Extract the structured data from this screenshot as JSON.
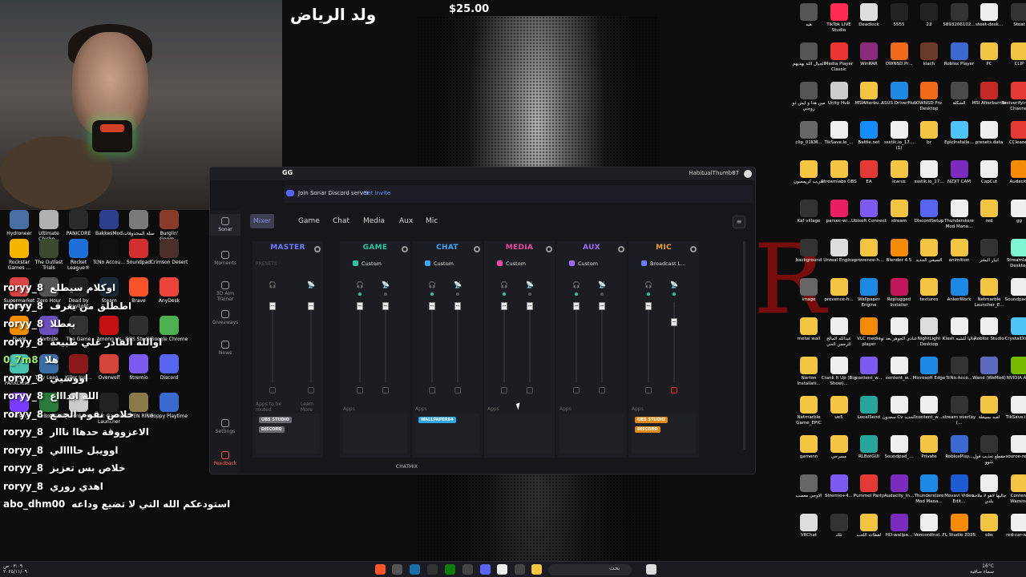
{
  "stream_overlay": {
    "title_arabic": "ولد الرياض",
    "donation": "$25.00"
  },
  "left_desktop_icons": [
    {
      "label": "Hydroneer",
      "color": "#4a6fa5"
    },
    {
      "label": "Ultimate Chicke...",
      "color": "#b0b0b0"
    },
    {
      "label": "PANICORE",
      "color": "#2a2a2a"
    },
    {
      "label": "BakkesMod",
      "color": "#2d3e8c"
    },
    {
      "label": "سلة المحذوفات",
      "color": "#7a7a7a"
    },
    {
      "label": "Burglin' Gnom...",
      "color": "#8a3a2a"
    },
    {
      "label": "Rockstar Games ...",
      "color": "#f4b400"
    },
    {
      "label": "The Outlast Trials",
      "color": "#3b4a2e"
    },
    {
      "label": "Rocket League®",
      "color": "#1e6fd9"
    },
    {
      "label": "TcNo Accou...",
      "color": "#111111"
    },
    {
      "label": "Soundpad",
      "color": "#d32f2f"
    },
    {
      "label": "Crimson Desert",
      "color": "#4a2f2a"
    },
    {
      "label": "Supermarket Togethe...",
      "color": "#d94545"
    },
    {
      "label": "Zero Hour",
      "color": "#555555"
    },
    {
      "label": "Dead by Daylight",
      "color": "#222222"
    },
    {
      "label": "Steam",
      "color": "#1b2838"
    },
    {
      "label": "Brave",
      "color": "#fb542b"
    },
    {
      "label": "AnyDesk",
      "color": "#ef443b"
    },
    {
      "label": "FiveM",
      "color": "#f08c00"
    },
    {
      "label": "Fortnite",
      "color": "#6b4fbb"
    },
    {
      "label": "The Game",
      "color": "#333333"
    },
    {
      "label": "Among Us",
      "color": "#c51111"
    },
    {
      "label": "OBS Studio",
      "color": "#302e31"
    },
    {
      "label": "Google Chrome",
      "color": "#4caf50"
    },
    {
      "label": "PICO PARKClass...",
      "color": "#49c3b1"
    },
    {
      "label": "Tiny Leag...",
      "color": "#3a6ea5"
    },
    {
      "label": "Killer Inst...",
      "color": "#8a1a1a"
    },
    {
      "label": "Overwolf",
      "color": "#d4463a"
    },
    {
      "label": "Stremio",
      "color": "#7b5bf2"
    },
    {
      "label": "Discord",
      "color": "#5865f2"
    },
    {
      "label": "Parsec",
      "color": "#7a3cff"
    },
    {
      "label": "RLBotGUI",
      "color": "#2a7a3a"
    },
    {
      "label": "Vencord Inst...",
      "color": "#cccccc"
    },
    {
      "label": "Epic Games Launcher",
      "color": "#222222"
    },
    {
      "label": "ELDEN RING",
      "color": "#8a7a4a"
    },
    {
      "label": "Poppy Playtime",
      "color": "#3a6ad0"
    }
  ],
  "chat": [
    {
      "user": "roryy_8",
      "msg": "اوكلام سيطلع"
    },
    {
      "user": "roryy_8",
      "msg": "اططلق من يعرف"
    },
    {
      "user": "roryy_8",
      "msg": "يعطلا"
    },
    {
      "user": "roryy_8",
      "msg": "اوالله القادر علي طبيعة"
    },
    {
      "user": "0_7m8",
      "msg": "هلا"
    },
    {
      "user": "roryy_8",
      "msg": "اووسيي"
    },
    {
      "user": "roryy_8",
      "msg": "الله ابداااع"
    },
    {
      "user": "roryy_8",
      "msg": "خلاص نقوم الجمع"
    },
    {
      "user": "roryy_8",
      "msg": "الاعزووقة حدهاا نااار"
    },
    {
      "user": "roryy_8",
      "msg": "اوويبل حاااالي"
    },
    {
      "user": "roryy_8",
      "msg": "خلاص بس تعزيز"
    },
    {
      "user": "roryy_8",
      "msg": "اهدي روري"
    },
    {
      "user": "abo_dhm00",
      "msg": "استودعكم الله التي لا تضيع وداعه"
    }
  ],
  "sonar": {
    "window_title": "GG",
    "username": "HabitualThumb87",
    "discord_banner": "Join Sonar Discord server",
    "discord_link": "Get invite",
    "nav": [
      {
        "label": "Sonar",
        "active": true
      },
      {
        "label": "Moments"
      },
      {
        "label": "3D Aim Trainer"
      },
      {
        "label": "Giveaways"
      },
      {
        "label": "News"
      },
      {
        "label": "Settings"
      },
      {
        "label": "Feedback"
      }
    ],
    "tabs": [
      "Mixer",
      "Game",
      "Chat",
      "Media",
      "Aux",
      "Mic"
    ],
    "presets_label": "PRESETS",
    "apps_label": "Apps",
    "apps_to_be_routed": "Apps to be routed",
    "learn_more": "Learn More",
    "chatmix_label": "CHATMIX",
    "channels": [
      {
        "name": "MASTER",
        "color": "#6e7cff",
        "preset": "",
        "preset_color": "",
        "mon_level": 0.05,
        "stream_level": 0.05,
        "chips": [
          {
            "text": "OBS STUDIO",
            "bg": "#6b6d75"
          },
          {
            "text": "DISCORD",
            "bg": "#6b6d75"
          }
        ]
      },
      {
        "name": "GAME",
        "color": "#2ec4a0",
        "preset": "Custom",
        "preset_color": "#2ec4a0",
        "mon_level": 0.05,
        "stream_level": 0.05,
        "chips": []
      },
      {
        "name": "CHAT",
        "color": "#3ba6f5",
        "preset": "Custom",
        "preset_color": "#3ba6f5",
        "mon_level": 0.05,
        "stream_level": 0.05,
        "chips": [
          {
            "text": "WALLPAPER64",
            "bg": "#2fa6e6"
          }
        ]
      },
      {
        "name": "MEDIA",
        "color": "#e94aa0",
        "preset": "Custom",
        "preset_color": "#e94aa0",
        "mon_level": 0.05,
        "stream_level": 0.05,
        "chips": []
      },
      {
        "name": "AUX",
        "color": "#9b6cf2",
        "preset": "Custom",
        "preset_color": "#9b6cf2",
        "mon_level": 0.05,
        "stream_level": 0.05,
        "chips": []
      },
      {
        "name": "MIC",
        "color": "#f0a030",
        "preset": "Broadcast L...",
        "preset_color": "#6e7cff",
        "mon_level": 0.05,
        "stream_level": 0.25,
        "chips": [
          {
            "text": "OBS STUDIO",
            "bg": "#e08a1a"
          },
          {
            "text": "DISCORD",
            "bg": "#e08a1a"
          }
        ]
      }
    ]
  },
  "right_desktop_icons": [
    {
      "label": "هيه",
      "color": "#555"
    },
    {
      "label": "TikTok LIVE Studio",
      "color": "#fe2c55"
    },
    {
      "label": "Deadlock",
      "color": "#ddd"
    },
    {
      "label": "5555",
      "color": "#222"
    },
    {
      "label": "22",
      "color": "#222"
    },
    {
      "label": "5893206102...",
      "color": "#333"
    },
    {
      "label": "stoet-desk...",
      "color": "#eee"
    },
    {
      "label": "Stoat",
      "color": "#333"
    },
    {
      "label": "الجبال الله يهديهم",
      "color": "#555"
    },
    {
      "label": "Media Player Classic",
      "color": "#e33"
    },
    {
      "label": "WinRAR",
      "color": "#8a2a7a"
    },
    {
      "label": "OWNSD.Pr...",
      "color": "#f06a1a"
    },
    {
      "label": "klach",
      "color": "#6a3a2a"
    },
    {
      "label": "Roblox Player",
      "color": "#3a6ad0"
    },
    {
      "label": "PC",
      "color": "#f4c542"
    },
    {
      "label": "CLIP",
      "color": "#f4c542"
    },
    {
      "label": "مين هذا و ايش ذو زوجتي",
      "color": "#555"
    },
    {
      "label": "Unity Hub",
      "color": "#ccc"
    },
    {
      "label": "MSIAfterbu...",
      "color": "#f4c542"
    },
    {
      "label": "ASUS DriverHub",
      "color": "#1e88e5"
    },
    {
      "label": "OWNSD Pro Desktop",
      "color": "#f06a1a"
    },
    {
      "label": "الشكلة",
      "color": "#4a4a4a"
    },
    {
      "label": "MSI Afterburner",
      "color": "#c62828"
    },
    {
      "label": "Textverifyin... to Channel",
      "color": "#e53935"
    },
    {
      "label": "clip_01KM...",
      "color": "#666"
    },
    {
      "label": "TikSave.io_...",
      "color": "#eee"
    },
    {
      "label": "Battle.net",
      "color": "#148eff"
    },
    {
      "label": "ssstik.io_17... (1)",
      "color": "#eee"
    },
    {
      "label": "br",
      "color": "#f4c542"
    },
    {
      "label": "EpicInstalle...",
      "color": "#4fc3f7"
    },
    {
      "label": "presets.data",
      "color": "#eee"
    },
    {
      "label": "CCleaner",
      "color": "#e53935"
    },
    {
      "label": "تعريب كريمسون",
      "color": "#f4c542"
    },
    {
      "label": "Streamlabs OBS",
      "color": "#f4c542"
    },
    {
      "label": "EA",
      "color": "#e53935"
    },
    {
      "label": "Icarus",
      "color": "#f4c542"
    },
    {
      "label": "ssstik.io_17...",
      "color": "#eee"
    },
    {
      "label": "NZXT CAM",
      "color": "#7b2cbf"
    },
    {
      "label": "CapCut",
      "color": "#eee"
    },
    {
      "label": "Audacity",
      "color": "#f58a07"
    },
    {
      "label": "Kaf village",
      "color": "#333"
    },
    {
      "label": "parsec-wi...",
      "color": "#e91e63"
    },
    {
      "label": "Ubisoft Connect",
      "color": "#7b5bf2"
    },
    {
      "label": "stream",
      "color": "#f4c542"
    },
    {
      "label": "DiscordSetup",
      "color": "#5865f2"
    },
    {
      "label": "Thunderstore Mod Mana...",
      "color": "#eee"
    },
    {
      "label": "red",
      "color": "#f4c542"
    },
    {
      "label": "gg",
      "color": "#eee"
    },
    {
      "label": "background",
      "color": "#333"
    },
    {
      "label": "Unreal Engine",
      "color": "#ddd"
    },
    {
      "label": "provence-h...",
      "color": "#f4c542"
    },
    {
      "label": "Blender 4.5",
      "color": "#f58a07"
    },
    {
      "label": "السيفي الجديد",
      "color": "#f4c542"
    },
    {
      "label": "animition",
      "color": "#f4c542"
    },
    {
      "label": "ابيار البشر",
      "color": "#333"
    },
    {
      "label": "Streamlabs Desktop",
      "color": "#80f5d2"
    },
    {
      "label": "image",
      "color": "#666"
    },
    {
      "label": "provence-h...",
      "color": "#f4c542"
    },
    {
      "label": "Wallpaper Engine",
      "color": "#1e88e5"
    },
    {
      "label": "Replugged Installer",
      "color": "#c2185b"
    },
    {
      "label": "textures",
      "color": "#f4c542"
    },
    {
      "label": "AnkerWork",
      "color": "#1e88e5"
    },
    {
      "label": "Netmarble Launcher_E...",
      "color": "#f4c542"
    },
    {
      "label": "Soundpad_...",
      "color": "#eee"
    },
    {
      "label": "metal wall",
      "color": "#f4c542"
    },
    {
      "label": "عبدالله المالح للرحمن الحي",
      "color": "#eee"
    },
    {
      "label": "VLC media player",
      "color": "#f58a07"
    },
    {
      "label": "عنادي الجوهر بعد تو",
      "color": "#eee"
    },
    {
      "label": "NightLight Desktop",
      "color": "#ddd"
    },
    {
      "label": "Klash جاليا للشبه",
      "color": "#eee"
    },
    {
      "label": "Roblox Studio",
      "color": "#eee"
    },
    {
      "label": "CrystalDiskM",
      "color": "#4fc3f7"
    },
    {
      "label": "Norton Installati...",
      "color": "#f4c542"
    },
    {
      "label": "Crank It Up (Big Show)...",
      "color": "#eee"
    },
    {
      "label": "content_w...",
      "color": "#7b5bf2"
    },
    {
      "label": "content_w...",
      "color": "#eee"
    },
    {
      "label": "Microsoft Edge",
      "color": "#1e88e5"
    },
    {
      "label": "TcNo.Acco...",
      "color": "#333"
    },
    {
      "label": "Wand (WeMod)",
      "color": "#5c6bc0"
    },
    {
      "label": "NVIDIA App",
      "color": "#76b900"
    },
    {
      "label": "Netmarble Game_EPIC",
      "color": "#f4c542"
    },
    {
      "label": "ue5",
      "color": "#f4c542"
    },
    {
      "label": "LocalSend",
      "color": "#26a69a"
    },
    {
      "label": "سعدون Cv الجديد",
      "color": "#eee"
    },
    {
      "label": "content_w...",
      "color": "#eee"
    },
    {
      "label": "stream overlay (...",
      "color": "#333"
    },
    {
      "label": "لعبه بسيطة",
      "color": "#f4c542"
    },
    {
      "label": "TikSave.io...",
      "color": "#eee"
    },
    {
      "label": "gamenn",
      "color": "#f4c542"
    },
    {
      "label": "مسرحي",
      "color": "#f4c542"
    },
    {
      "label": "RLBotGUI",
      "color": "#26a69a"
    },
    {
      "label": "Soundpad_...",
      "color": "#eee"
    },
    {
      "label": "Private",
      "color": "#f4c542"
    },
    {
      "label": "RobloxPlay...",
      "color": "#3a6ad0"
    },
    {
      "label": "مقطع تعذيب فول شوو",
      "color": "#333"
    },
    {
      "label": "source-rec...",
      "color": "#eee"
    },
    {
      "label": "الاوجي معصب",
      "color": "#666"
    },
    {
      "label": "Stremio+4...",
      "color": "#7b5bf2"
    },
    {
      "label": "Pummel Party",
      "color": "#e53935"
    },
    {
      "label": "Audacity_In...",
      "color": "#7b2cbf"
    },
    {
      "label": "Thunderstore Mod Mana...",
      "color": "#1e88e5"
    },
    {
      "label": "Movavi Video Edit...",
      "color": "#1e5bd0"
    },
    {
      "label": "جاليها لاهو لا ملاحة بلدي",
      "color": "#eee"
    },
    {
      "label": "Content Warning",
      "color": "#f4c542"
    },
    {
      "label": "VRChat",
      "color": "#ddd"
    },
    {
      "label": "تلك",
      "color": "#333"
    },
    {
      "label": "لقطات اللعب",
      "color": "#f4c542"
    },
    {
      "label": "HD-wallpa...",
      "color": "#7b2cbf"
    },
    {
      "label": "VencordInst...",
      "color": "#eee"
    },
    {
      "label": "FL Studio 2025",
      "color": "#f58a07"
    },
    {
      "label": "obs",
      "color": "#f4c542"
    },
    {
      "label": "red-car-wr...",
      "color": "#eee"
    }
  ],
  "taskbar": {
    "clock": "٠٣:٠٩ ص",
    "date": "٢٠٢٥/١١/٠٩",
    "search_placeholder": "بحث",
    "weather_temp": "16°C",
    "weather_text": "سماء صافية",
    "apps": [
      {
        "name": "brave",
        "color": "#fb542b"
      },
      {
        "name": "obs",
        "color": "#555"
      },
      {
        "name": "steam",
        "color": "#1b6fa8"
      },
      {
        "name": "epic",
        "color": "#333"
      },
      {
        "name": "xbox",
        "color": "#107c10"
      },
      {
        "name": "controller",
        "color": "#444"
      },
      {
        "name": "discord",
        "color": "#5865f2"
      },
      {
        "name": "steelseries",
        "color": "#eee"
      },
      {
        "name": "calculator",
        "color": "#444"
      },
      {
        "name": "file-explorer",
        "color": "#f4c542"
      },
      {
        "name": "notepad",
        "color": "#ddd"
      },
      {
        "name": "widgets",
        "color": "#2196f3"
      }
    ]
  }
}
